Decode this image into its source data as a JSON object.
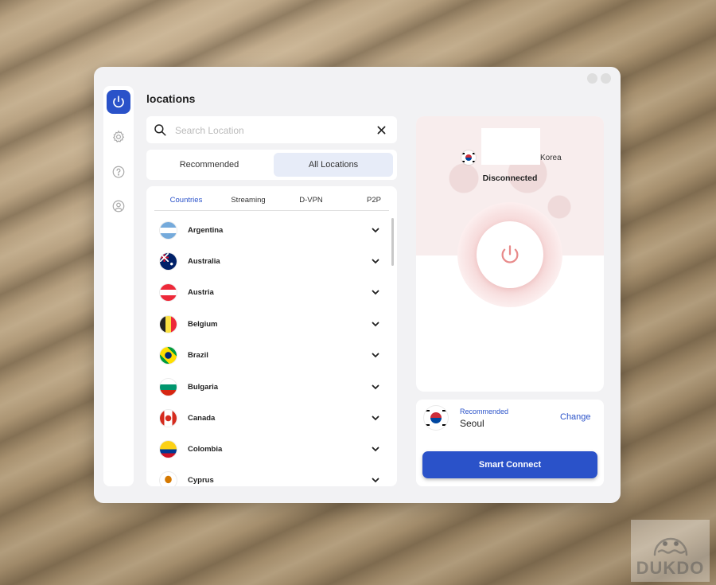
{
  "page": {
    "title": "locations"
  },
  "search": {
    "placeholder": "Search Location",
    "value": ""
  },
  "segments": [
    {
      "label": "Recommended",
      "active": false
    },
    {
      "label": "All Locations",
      "active": true
    }
  ],
  "subtabs": [
    {
      "label": "Countries",
      "active": true
    },
    {
      "label": "Streaming",
      "active": false
    },
    {
      "label": "D-VPN",
      "active": false
    },
    {
      "label": "P2P",
      "active": false
    }
  ],
  "countries": [
    "Argentina",
    "Australia",
    "Austria",
    "Belgium",
    "Brazil",
    "Bulgaria",
    "Canada",
    "Colombia",
    "Cyprus"
  ],
  "status": {
    "location": "Korea",
    "connection": "Disconnected"
  },
  "recommended": {
    "label": "Recommended",
    "city": "Seoul",
    "change_label": "Change"
  },
  "actions": {
    "connect_label": "Smart Connect"
  },
  "watermark": {
    "text": "DUKDO"
  },
  "colors": {
    "accent": "#2a52c9",
    "disconnected": "#e88a8a",
    "window_bg": "#f2f2f4"
  },
  "icons": {
    "sidebar": [
      "power-icon",
      "gear-icon",
      "help-icon",
      "account-icon"
    ],
    "search": "search-icon",
    "clear": "close-icon",
    "row": "chevron-down-icon"
  }
}
